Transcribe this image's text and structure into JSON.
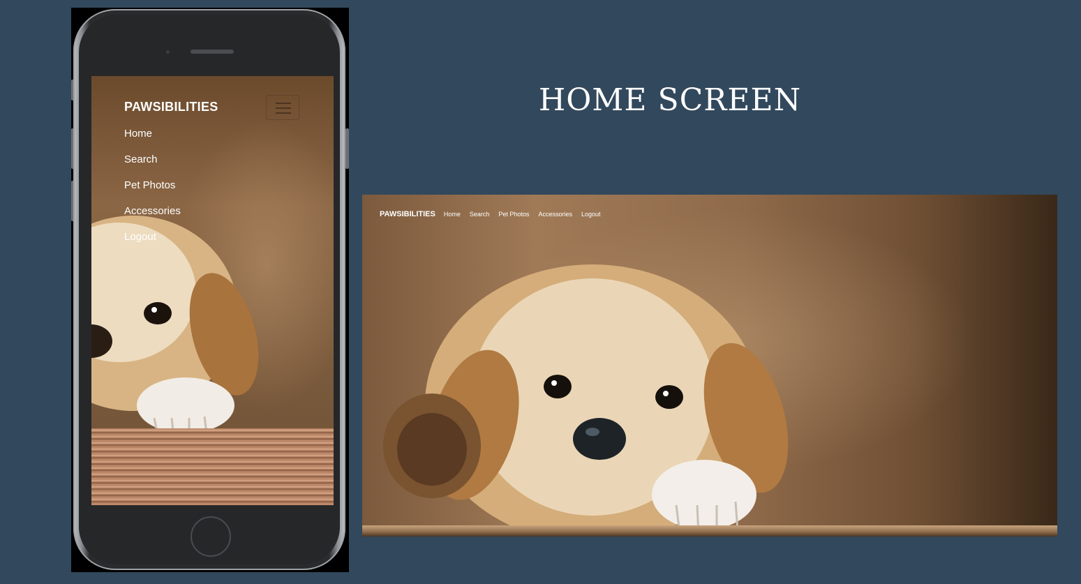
{
  "title": "HOME SCREEN",
  "mobile": {
    "brand": "PAWSIBILITIES",
    "menu_icon": "hamburger-icon",
    "nav": [
      "Home",
      "Search",
      "Pet Photos",
      "Accessories",
      "Logout"
    ]
  },
  "desktop": {
    "brand": "PAWSIBILITIES",
    "nav": [
      "Home",
      "Search",
      "Pet Photos",
      "Accessories",
      "Logout"
    ]
  },
  "colors": {
    "background": "#32485c",
    "nav_text": "#ffffff",
    "image_tone": "#8b6645"
  }
}
